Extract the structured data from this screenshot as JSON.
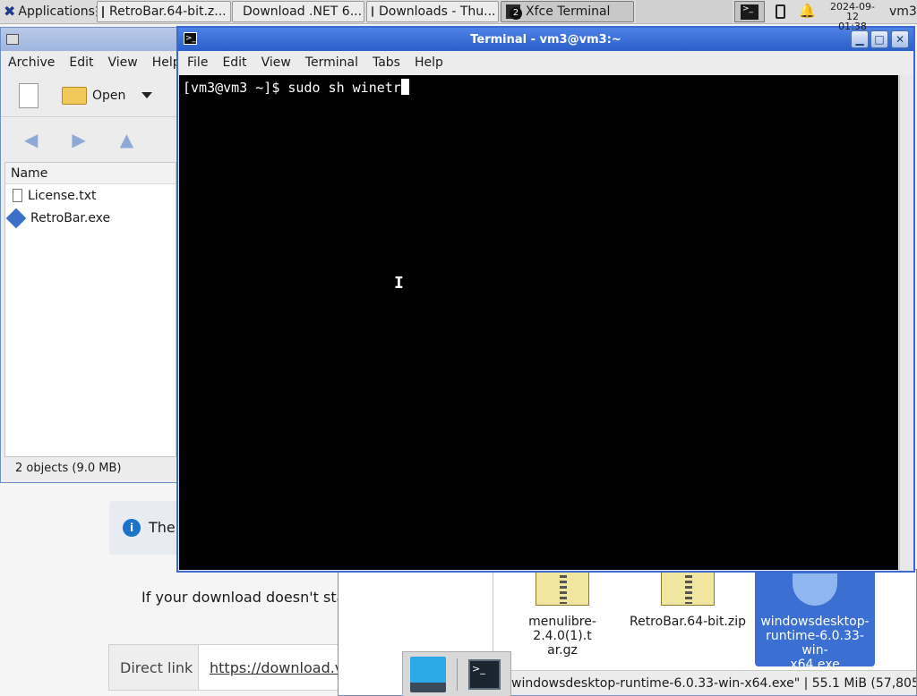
{
  "panel": {
    "applications_label": "Applications",
    "tasks": [
      {
        "label": "RetroBar.64-bit.z...",
        "icon": "archive-icon"
      },
      {
        "label": "Download .NET 6...",
        "icon": "firefox-icon"
      },
      {
        "label": "Downloads - Thu...",
        "icon": "folder-icon"
      },
      {
        "label": "Xfce Terminal",
        "icon": "terminal-icon",
        "badge": "2"
      }
    ],
    "date": "2024-09-12",
    "time": "01:38",
    "user": "vm3"
  },
  "archive_window": {
    "menu": [
      "Archive",
      "Edit",
      "View",
      "Help"
    ],
    "open_label": "Open",
    "column_name": "Name",
    "files": [
      "License.txt",
      "RetroBar.exe"
    ],
    "status": "2 objects (9.0 MB)"
  },
  "terminal": {
    "title": "Terminal - vm3@vm3:~",
    "menu": [
      "File",
      "Edit",
      "View",
      "Terminal",
      "Tabs",
      "Help"
    ],
    "prompt": "[vm3@vm3 ~]$ sudo sh winetr"
  },
  "webpage": {
    "notice_text": "The",
    "download_text": "If your download doesn't star",
    "direct_link_label": "Direct link",
    "direct_link_url": "https://download.v"
  },
  "thunar": {
    "files": [
      {
        "name": "menulibre-2.4.0(1).tar.gz",
        "display": [
          "menulibre-2.4.0(1).t",
          "ar.gz"
        ]
      },
      {
        "name": "RetroBar.64-bit.zip",
        "display": [
          "RetroBar.64-bit.zip"
        ]
      },
      {
        "name": "windowsdesktop-runtime-6.0.33-win-x64.exe",
        "display": [
          "windowsdesktop-",
          "runtime-6.0.33-win-",
          "x64.exe"
        ]
      }
    ],
    "status": "windowsdesktop-runtime-6.0.33-win-x64.exe\"  |  55.1 MiB (57,805,1..."
  },
  "colors": {
    "accent": "#3d6fd0",
    "terminal_bg": "#000000",
    "terminal_fg": "#ffffff",
    "selection": "#3b6fd1"
  }
}
